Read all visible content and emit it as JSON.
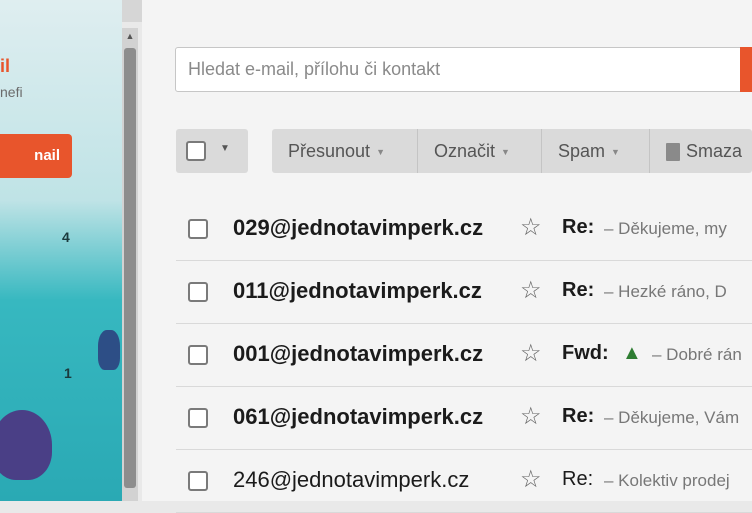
{
  "sidebar": {
    "logo_text": "il",
    "logo_sub": "nefi",
    "compose_label": "nail",
    "folder_counts": [
      "4",
      "1"
    ]
  },
  "search": {
    "placeholder": "Hledat e-mail, přílohu či kontakt"
  },
  "toolbar": {
    "move_label": "Přesunout",
    "mark_label": "Označit",
    "spam_label": "Spam",
    "delete_label": "Smaza"
  },
  "messages": [
    {
      "sender": "029@jednotavimperk.cz",
      "subject": "Re:",
      "snippet": "– Děkujeme, my",
      "read": false
    },
    {
      "sender": "011@jednotavimperk.cz",
      "subject": "Re:",
      "snippet": "– Hezké ráno, D",
      "read": false
    },
    {
      "sender": "001@jednotavimperk.cz",
      "subject": "Fwd:",
      "snippet": "– Dobré rán",
      "read": false,
      "icon": "tree-icon"
    },
    {
      "sender": "061@jednotavimperk.cz",
      "subject": "Re:",
      "snippet": "– Děkujeme, Vám",
      "read": false
    },
    {
      "sender": "246@jednotavimperk.cz",
      "subject": "Re:",
      "snippet": "– Kolektiv prodej",
      "read": true
    }
  ],
  "colors": {
    "accent": "#e8552c",
    "sidebar_teal": "#2aa9b4"
  }
}
